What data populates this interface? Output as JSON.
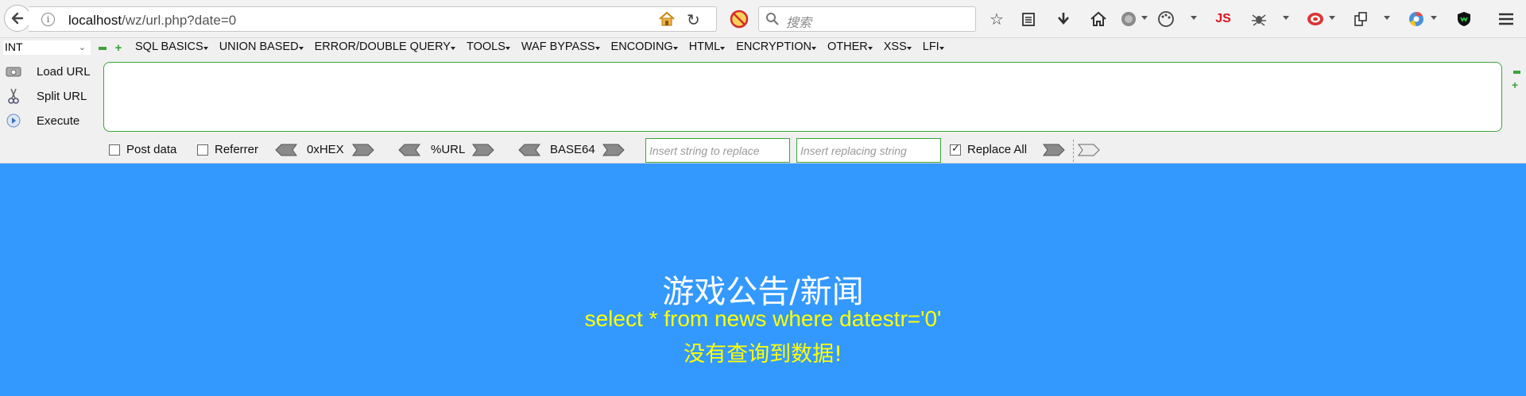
{
  "browser": {
    "url_host": "localhost",
    "url_path": "/wz/url.php?date=0",
    "search_placeholder": "搜索",
    "toolbar_icons": [
      "star-icon",
      "reader-icon",
      "download-icon",
      "home-icon",
      "globe-icon",
      "palette-icon",
      "js-icon",
      "spider-icon",
      "target-icon",
      "copy-icon",
      "chrome-icon",
      "shield-icon",
      "menu-icon"
    ],
    "js_label": "JS"
  },
  "hackbar": {
    "type_select": "INT",
    "menu": [
      "SQL BASICS",
      "UNION BASED",
      "ERROR/DOUBLE QUERY",
      "TOOLS",
      "WAF BYPASS",
      "ENCODING",
      "HTML",
      "ENCRYPTION",
      "OTHER",
      "XSS",
      "LFI"
    ],
    "actions": {
      "load": "Load URL",
      "split": "Split URL",
      "execute": "Execute"
    },
    "textarea_value": "",
    "options": {
      "post_data": "Post data",
      "referrer": "Referrer",
      "hex": "0xHEX",
      "url": "%URL",
      "base64": "BASE64",
      "replace_find_placeholder": "Insert string to replace",
      "replace_with_placeholder": "Insert replacing string",
      "replace_all": "Replace All",
      "replace_all_checked": true,
      "post_data_checked": false,
      "referrer_checked": false
    }
  },
  "page": {
    "title": "游戏公告/新闻",
    "sql": "select * from news where datestr='0'",
    "message": "没有查询到数据!"
  },
  "colors": {
    "page_background": "#3399ff",
    "highlight_text": "#ffff00",
    "hackbar_accent": "#3aa53a"
  }
}
